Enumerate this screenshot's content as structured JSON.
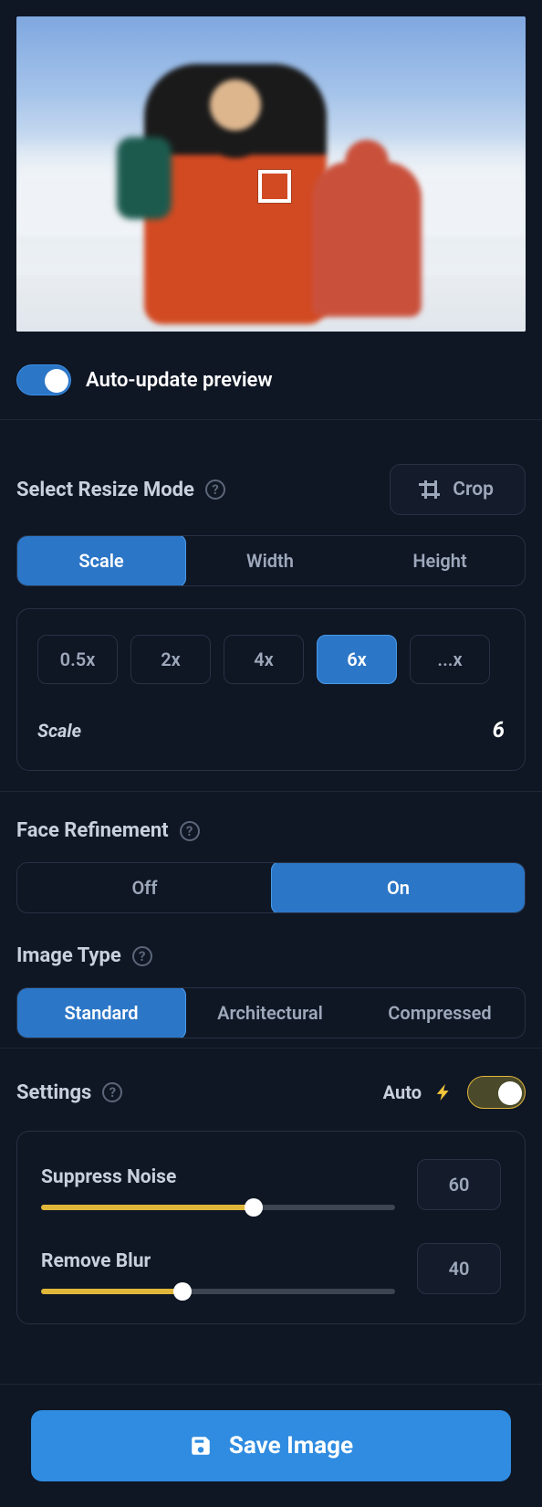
{
  "autoUpdate": {
    "label": "Auto-update preview",
    "on": true
  },
  "resize": {
    "title": "Select Resize Mode",
    "crop": "Crop",
    "tabs": {
      "scale": "Scale",
      "width": "Width",
      "height": "Height",
      "active": "scale"
    },
    "scales": [
      "0.5x",
      "2x",
      "4x",
      "6x",
      "...x"
    ],
    "scaleActive": "6x",
    "readoutLabel": "Scale",
    "readoutValue": "6"
  },
  "face": {
    "title": "Face Refinement",
    "off": "Off",
    "on": "On",
    "active": "on"
  },
  "imageType": {
    "title": "Image Type",
    "options": [
      "Standard",
      "Architectural",
      "Compressed"
    ],
    "active": "Standard"
  },
  "settings": {
    "title": "Settings",
    "autoLabel": "Auto",
    "autoOn": true,
    "sliders": [
      {
        "key": "noise",
        "label": "Suppress Noise",
        "value": 60
      },
      {
        "key": "blur",
        "label": "Remove Blur",
        "value": 40
      }
    ]
  },
  "save": {
    "label": "Save Image"
  }
}
